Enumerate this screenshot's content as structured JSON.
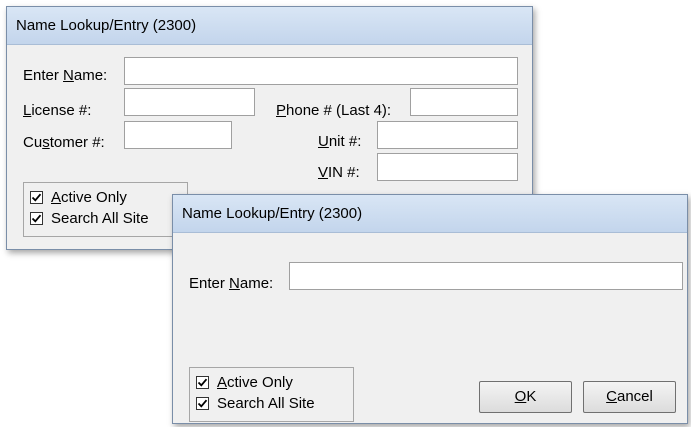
{
  "dialog_back": {
    "title": "Name Lookup/Entry (2300)",
    "enter_name_label": [
      "Enter ",
      "N",
      "ame:"
    ],
    "license_label": [
      "",
      "L",
      "icense #:"
    ],
    "customer_label": [
      "Cu",
      "s",
      "tomer #:"
    ],
    "phone_label": [
      "",
      "P",
      "hone # (Last 4):"
    ],
    "unit_label": [
      "",
      "U",
      "nit #:"
    ],
    "vin_label": [
      "",
      "V",
      "IN #:"
    ],
    "active_only": [
      "",
      "A",
      "ctive Only"
    ],
    "search_all_site": "Search All Site"
  },
  "dialog_front": {
    "title": "Name Lookup/Entry (2300)",
    "enter_name_label": [
      "Enter ",
      "N",
      "ame:"
    ],
    "active_only": [
      "",
      "A",
      "ctive Only"
    ],
    "search_all_site": "Search All Site",
    "ok_label": [
      "",
      "O",
      "K"
    ],
    "cancel_label": [
      "",
      "C",
      "ancel"
    ]
  }
}
